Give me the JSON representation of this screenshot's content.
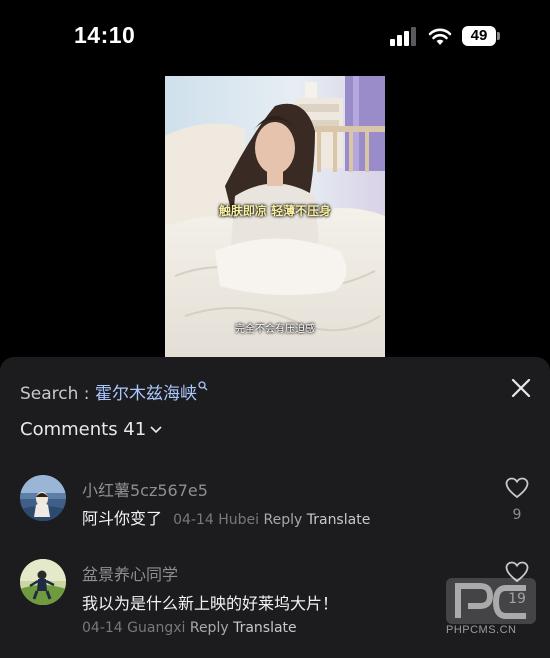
{
  "status_bar": {
    "time": "14:10",
    "battery_level": "49"
  },
  "video": {
    "caption_top": "触肤即凉 轻薄不压身",
    "caption_bottom": "完全不会有压迫感"
  },
  "search": {
    "prefix": "Search : ",
    "term": "霍尔木兹海峡"
  },
  "comments_header": {
    "label": "Comments 41"
  },
  "comments": [
    {
      "username": "小红薯5cz567e5",
      "text": "阿斗你变了",
      "date": "04-14",
      "location": "Hubei",
      "reply_label": "Reply",
      "translate_label": "Translate",
      "likes": "9"
    },
    {
      "username": "盆景养心同学",
      "text": "我以为是什么新上映的好莱坞大片！",
      "date": "04-14",
      "location": "Guangxi",
      "reply_label": "Reply",
      "translate_label": "Translate",
      "likes": "19"
    }
  ],
  "watermark": {
    "text": "PHPCMS.CN"
  },
  "colors": {
    "sheet_bg": "#1c1c1e",
    "search_term": "#aac8ff",
    "muted": "#8e8e93"
  }
}
